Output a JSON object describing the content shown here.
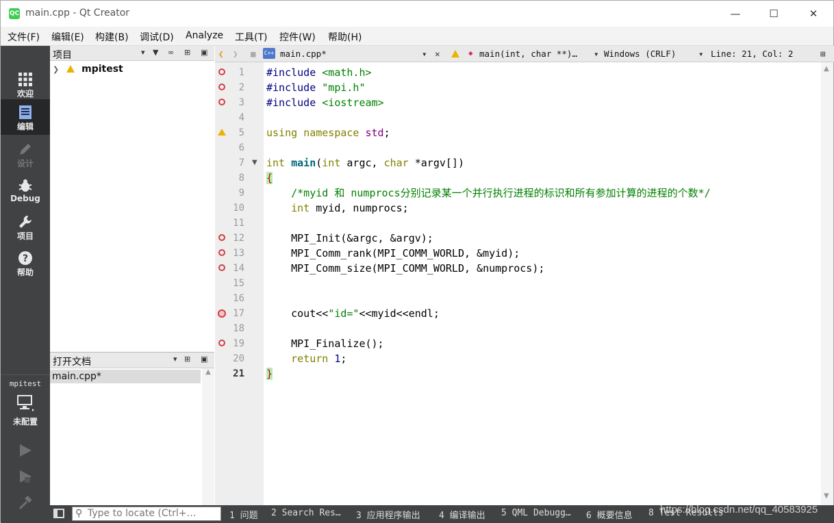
{
  "window": {
    "title": "main.cpp - Qt Creator",
    "logo": "QC"
  },
  "menu": [
    "文件(F)",
    "编辑(E)",
    "构建(B)",
    "调试(D)",
    "Analyze",
    "工具(T)",
    "控件(W)",
    "帮助(H)"
  ],
  "modes": [
    {
      "label": "欢迎",
      "icon": "grid-icon"
    },
    {
      "label": "编辑",
      "icon": "edit-icon"
    },
    {
      "label": "设计",
      "icon": "pencil-icon"
    },
    {
      "label": "Debug",
      "icon": "bug-icon"
    },
    {
      "label": "项目",
      "icon": "wrench-icon"
    },
    {
      "label": "帮助",
      "icon": "help-icon"
    }
  ],
  "kit": {
    "project": "mpitest",
    "config": "未配置"
  },
  "project_pane": {
    "title": "项目",
    "tree_item": "mpitest"
  },
  "open_docs": {
    "title": "打开文档",
    "items": [
      "main.cpp*"
    ]
  },
  "editor_toolbar": {
    "file": "main.cpp*",
    "symbol": "main(int, char **)…",
    "encoding": "Windows (CRLF)",
    "position": "Line: 21, Col: 2"
  },
  "code_lines": [
    "#include <math.h>",
    "#include \"mpi.h\"",
    "#include <iostream>",
    "",
    "using namespace std;",
    "",
    "int main(int argc, char *argv[])",
    "{",
    "    /*myid 和 numprocs分别记录某一个并行执行进程的标识和所有参加计算的进程的个数*/",
    "    int myid, numprocs;",
    "",
    "    MPI_Init(&argc, &argv);",
    "    MPI_Comm_rank(MPI_COMM_WORLD, &myid);",
    "    MPI_Comm_size(MPI_COMM_WORLD, &numprocs);",
    "",
    "",
    "    cout<<\"id=\"<<myid<<endl;",
    "",
    "    MPI_Finalize();",
    "    return 1;",
    "}"
  ],
  "status": {
    "locate_placeholder": "Type to locate (Ctrl+…",
    "tabs": [
      "1 问题",
      "2 Search Res…",
      "3 应用程序输出",
      "4 编译输出",
      "5 QML Debugg…",
      "6 概要信息",
      "8 Test Results"
    ],
    "watermark": "https://blog.csdn.net/qq_40583925"
  },
  "colors": {
    "accent": "#41cd52",
    "sidebar": "#404244",
    "breakpoint": "#d04040"
  }
}
